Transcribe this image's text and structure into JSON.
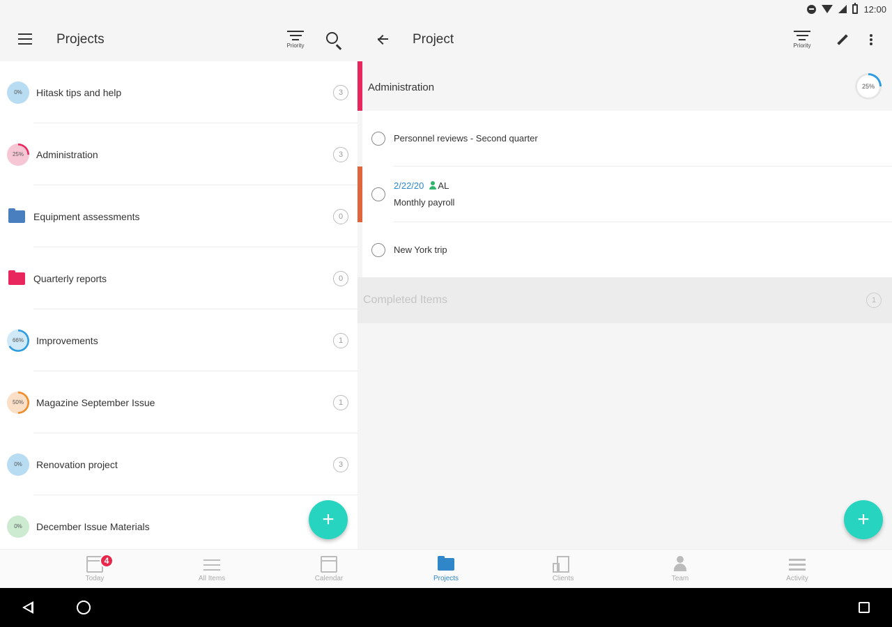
{
  "status_bar": {
    "time": "12:00"
  },
  "left": {
    "title": "Projects",
    "filter_label": "Priority",
    "projects": [
      {
        "name": "Hitask tips and help",
        "progress": "0%",
        "progress_value": 0,
        "count": "3",
        "type": "progress",
        "color": "#b8dcf2",
        "ring": "#b8dcf2"
      },
      {
        "name": "Administration",
        "progress": "25%",
        "progress_value": 25,
        "count": "3",
        "type": "progress",
        "color": "#f7c6d4",
        "ring": "#e8275e"
      },
      {
        "name": "Equipment assessments",
        "count": "0",
        "type": "folder",
        "color": "#4a7fbf"
      },
      {
        "name": "Quarterly reports",
        "count": "0",
        "type": "folder",
        "color": "#e8275e"
      },
      {
        "name": "Improvements",
        "progress": "66%",
        "progress_value": 66,
        "count": "1",
        "type": "progress",
        "color": "#cfe9f8",
        "ring": "#2f9be0"
      },
      {
        "name": "Magazine September Issue",
        "progress": "50%",
        "progress_value": 50,
        "count": "1",
        "type": "progress",
        "color": "#fbdfc6",
        "ring": "#f08c28"
      },
      {
        "name": "Renovation project",
        "progress": "0%",
        "progress_value": 0,
        "count": "3",
        "type": "progress",
        "color": "#b8dcf2",
        "ring": "#b8dcf2"
      },
      {
        "name": "December Issue Materials",
        "progress": "0%",
        "progress_value": 0,
        "count": "",
        "type": "progress",
        "color": "#cdebd0",
        "ring": "#cdebd0"
      }
    ],
    "fab_label": "+"
  },
  "right": {
    "title": "Project",
    "filter_label": "Priority",
    "project": {
      "name": "Administration",
      "progress": "25%",
      "progress_value": 25
    },
    "tasks": [
      {
        "title": "Personnel reviews - Second quarter"
      },
      {
        "title": "Monthly payroll",
        "date": "2/22/20",
        "assignee": "AL"
      },
      {
        "title": "New York trip"
      }
    ],
    "completed": {
      "label": "Completed Items",
      "count": "1"
    },
    "fab_label": "+"
  },
  "bottom_nav": {
    "items": [
      {
        "label": "Today",
        "badge": "4"
      },
      {
        "label": "All Items"
      },
      {
        "label": "Calendar"
      },
      {
        "label": "Projects",
        "active": true
      },
      {
        "label": "Clients"
      },
      {
        "label": "Team"
      },
      {
        "label": "Activity"
      }
    ]
  },
  "colors": {
    "accent": "#26d4c0",
    "active_nav": "#2f86c9",
    "project_pink": "#e8275e",
    "task_orange": "#e0653c",
    "date_blue": "#2f86c9"
  }
}
